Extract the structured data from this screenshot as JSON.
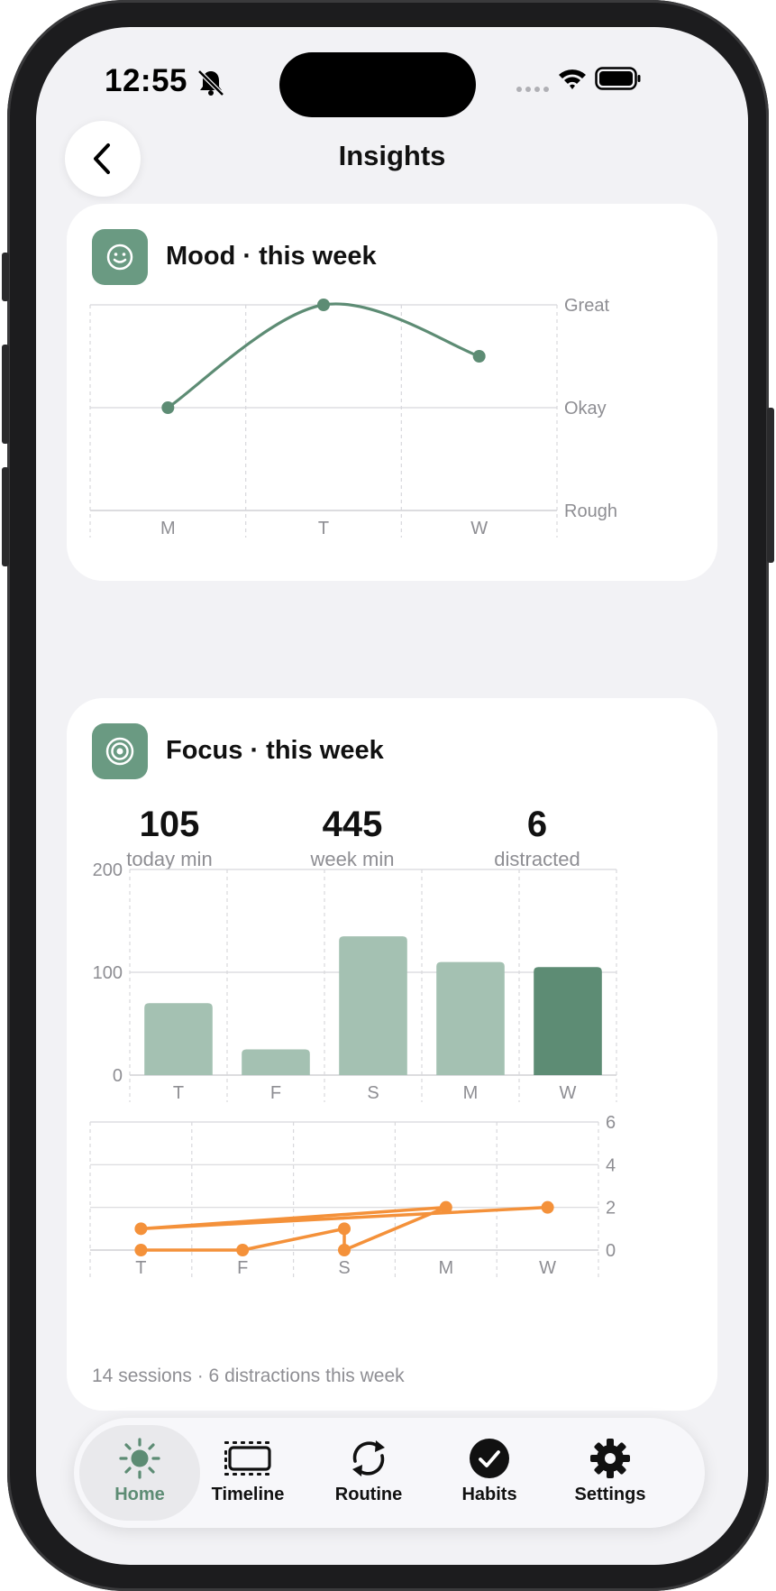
{
  "status": {
    "time": "12:55"
  },
  "header": {
    "title": "Insights"
  },
  "colors": {
    "accent": "#5d8c74",
    "bar_light": "#a4c1b2",
    "bar_active": "#5d8c74",
    "distraction": "#f4913a"
  },
  "mood": {
    "title": "Mood · this week",
    "icon": "smiley-icon",
    "chart_data": {
      "type": "line",
      "categories": [
        "M",
        "T",
        "W"
      ],
      "values": [
        1,
        2,
        1.5
      ],
      "y_levels": [
        "Rough",
        "Okay",
        "Great"
      ],
      "ylim": [
        0,
        2
      ],
      "grid": true
    }
  },
  "focus": {
    "title": "Focus · this week",
    "icon": "target-icon",
    "stats": [
      {
        "value": "105",
        "label": "today min"
      },
      {
        "value": "445",
        "label": "week min"
      },
      {
        "value": "6",
        "label": "distracted"
      }
    ],
    "bar_chart": {
      "type": "bar",
      "categories": [
        "T",
        "F",
        "S",
        "M",
        "W"
      ],
      "values": [
        70,
        25,
        135,
        110,
        105
      ],
      "highlight_index": 4,
      "yticks": [
        "0",
        "100",
        "200"
      ],
      "ylim": [
        0,
        200
      ],
      "grid": true
    },
    "distraction_chart": {
      "type": "line",
      "categories": [
        "T",
        "F",
        "S",
        "M",
        "W"
      ],
      "points": [
        {
          "x": "T",
          "y": 0
        },
        {
          "x": "F",
          "y": 0
        },
        {
          "x": "S",
          "y": 1
        },
        {
          "x": "S",
          "y": 0
        },
        {
          "x": "M",
          "y": 2
        },
        {
          "x": "T",
          "y": 1
        },
        {
          "x": "W",
          "y": 2
        }
      ],
      "yticks": [
        "0",
        "2",
        "4",
        "6"
      ],
      "ylim": [
        0,
        6
      ],
      "grid": true
    },
    "footer": "14 sessions · 6 distractions this week"
  },
  "tabs": [
    {
      "label": "Home",
      "icon": "sun-icon",
      "active": true
    },
    {
      "label": "Timeline",
      "icon": "timeline-icon",
      "active": false
    },
    {
      "label": "Routine",
      "icon": "refresh-icon",
      "active": false
    },
    {
      "label": "Habits",
      "icon": "checkmark-circle-icon",
      "active": false
    },
    {
      "label": "Settings",
      "icon": "gear-icon",
      "active": false
    }
  ]
}
